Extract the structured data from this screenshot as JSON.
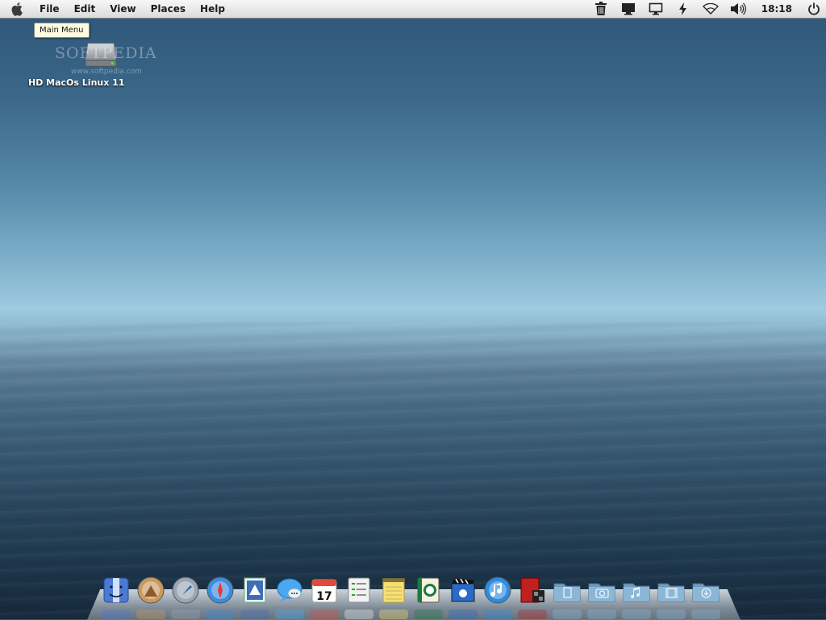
{
  "menubar": {
    "items": [
      "File",
      "Edit",
      "View",
      "Places",
      "Help"
    ],
    "clock": "18:18"
  },
  "tray_icons": [
    "trash-icon",
    "display-icon",
    "monitor-icon",
    "power-flash-icon",
    "wifi-icon",
    "volume-icon"
  ],
  "tooltip": "Main Menu",
  "desktop": {
    "hd_label": "HD MacOs Linux 11",
    "watermark": "SOFTPEDIA",
    "watermark_url": "www.softpedia.com"
  },
  "dock": {
    "apps": [
      {
        "name": "finder-icon",
        "color": "#4b79d6"
      },
      {
        "name": "mountain-lion-icon",
        "color": "#c99a60"
      },
      {
        "name": "launchpad-rocket-icon",
        "color": "#9aa6b4"
      },
      {
        "name": "safari-compass-icon",
        "color": "#3a8de0"
      },
      {
        "name": "mail-stamp-icon",
        "color": "#3d6fb8"
      },
      {
        "name": "messages-bubble-icon",
        "color": "#4aa8f0"
      },
      {
        "name": "calendar-icon",
        "color": "#e04a3a"
      },
      {
        "name": "reminders-icon",
        "color": "#f2f2f2"
      },
      {
        "name": "notes-icon",
        "color": "#f4e070"
      },
      {
        "name": "starbucks-book-icon",
        "color": "#1d7a3c"
      },
      {
        "name": "imovie-icon",
        "color": "#2a6ac8"
      },
      {
        "name": "itunes-icon",
        "color": "#2e8be0"
      },
      {
        "name": "photo-booth-icon",
        "color": "#c02020"
      }
    ],
    "folders": [
      {
        "name": "documents-folder-icon",
        "glyph": "doc"
      },
      {
        "name": "pictures-folder-icon",
        "glyph": "camera"
      },
      {
        "name": "music-folder-icon",
        "glyph": "note"
      },
      {
        "name": "movies-folder-icon",
        "glyph": "film"
      },
      {
        "name": "downloads-folder-icon",
        "glyph": "down"
      }
    ]
  }
}
